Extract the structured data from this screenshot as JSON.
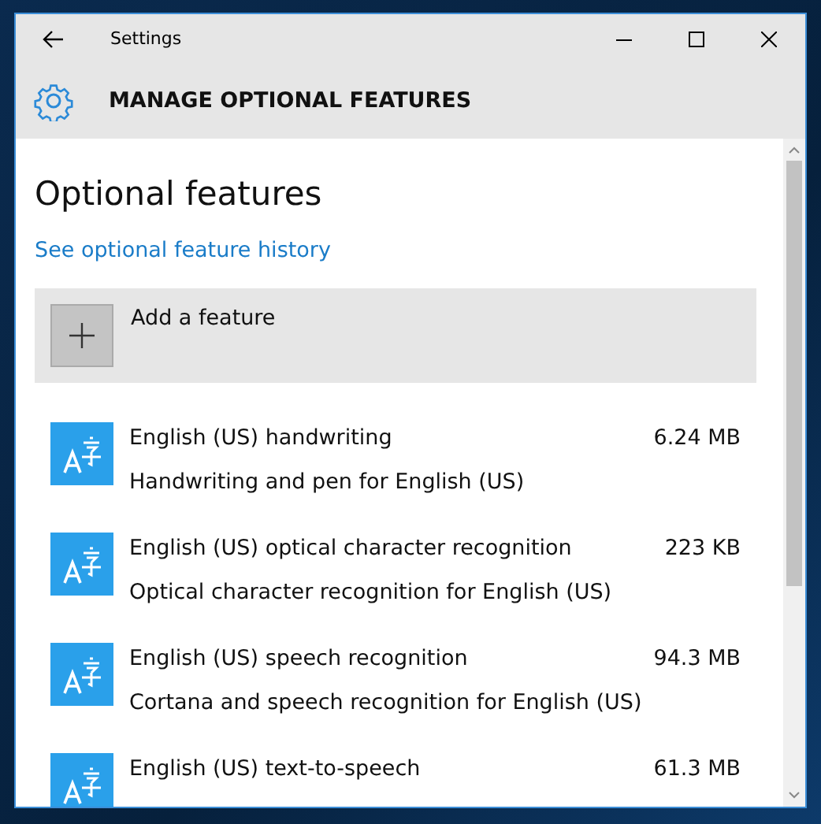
{
  "window": {
    "title": "Settings"
  },
  "header": {
    "title": "MANAGE OPTIONAL FEATURES"
  },
  "page": {
    "heading": "Optional features",
    "history_link": "See optional feature history",
    "add_button": "Add a feature"
  },
  "features": [
    {
      "name": "English (US) handwriting",
      "size": "6.24 MB",
      "description": "Handwriting and pen for English (US)"
    },
    {
      "name": "English (US) optical character recognition",
      "size": "223 KB",
      "description": "Optical character recognition for English (US)"
    },
    {
      "name": "English (US) speech recognition",
      "size": "94.3 MB",
      "description": "Cortana and speech recognition for English (US)"
    },
    {
      "name": "English (US) text-to-speech",
      "size": "61.3 MB"
    }
  ]
}
